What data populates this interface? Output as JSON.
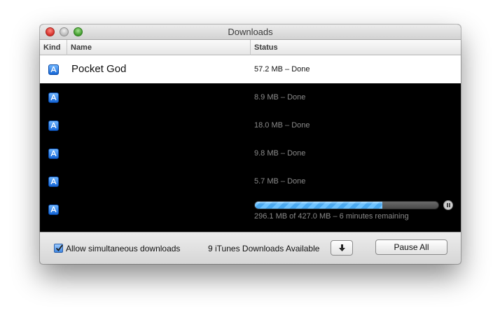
{
  "window": {
    "title": "Downloads"
  },
  "columns": {
    "kind": "Kind",
    "name": "Name",
    "status": "Status"
  },
  "downloads": [
    {
      "icon": "app-store-icon",
      "name": "Pocket God",
      "status": "57.2 MB – Done",
      "selected": true
    },
    {
      "icon": "app-store-icon",
      "name": "",
      "status": "8.9 MB – Done"
    },
    {
      "icon": "app-store-icon",
      "name": "",
      "status": "18.0 MB – Done"
    },
    {
      "icon": "app-store-icon",
      "name": "",
      "status": "9.8 MB – Done"
    },
    {
      "icon": "app-store-icon",
      "name": "",
      "status": "5.7 MB – Done"
    },
    {
      "icon": "app-store-icon",
      "name": "",
      "status": "296.1 MB of 427.0 MB – 6 minutes remaining",
      "progress": 0.693
    }
  ],
  "footer": {
    "allow_simultaneous_label": "Allow simultaneous downloads",
    "allow_simultaneous_checked": true,
    "available_text": "9 iTunes Downloads Available",
    "download_icon": "download-arrow-icon",
    "pause_all_label": "Pause All"
  },
  "colors": {
    "selected_row_bg": "#ffffff",
    "list_bg": "#000000",
    "progress_fill": "#6ec3ff",
    "app_icon_blue": "#1466d6"
  }
}
